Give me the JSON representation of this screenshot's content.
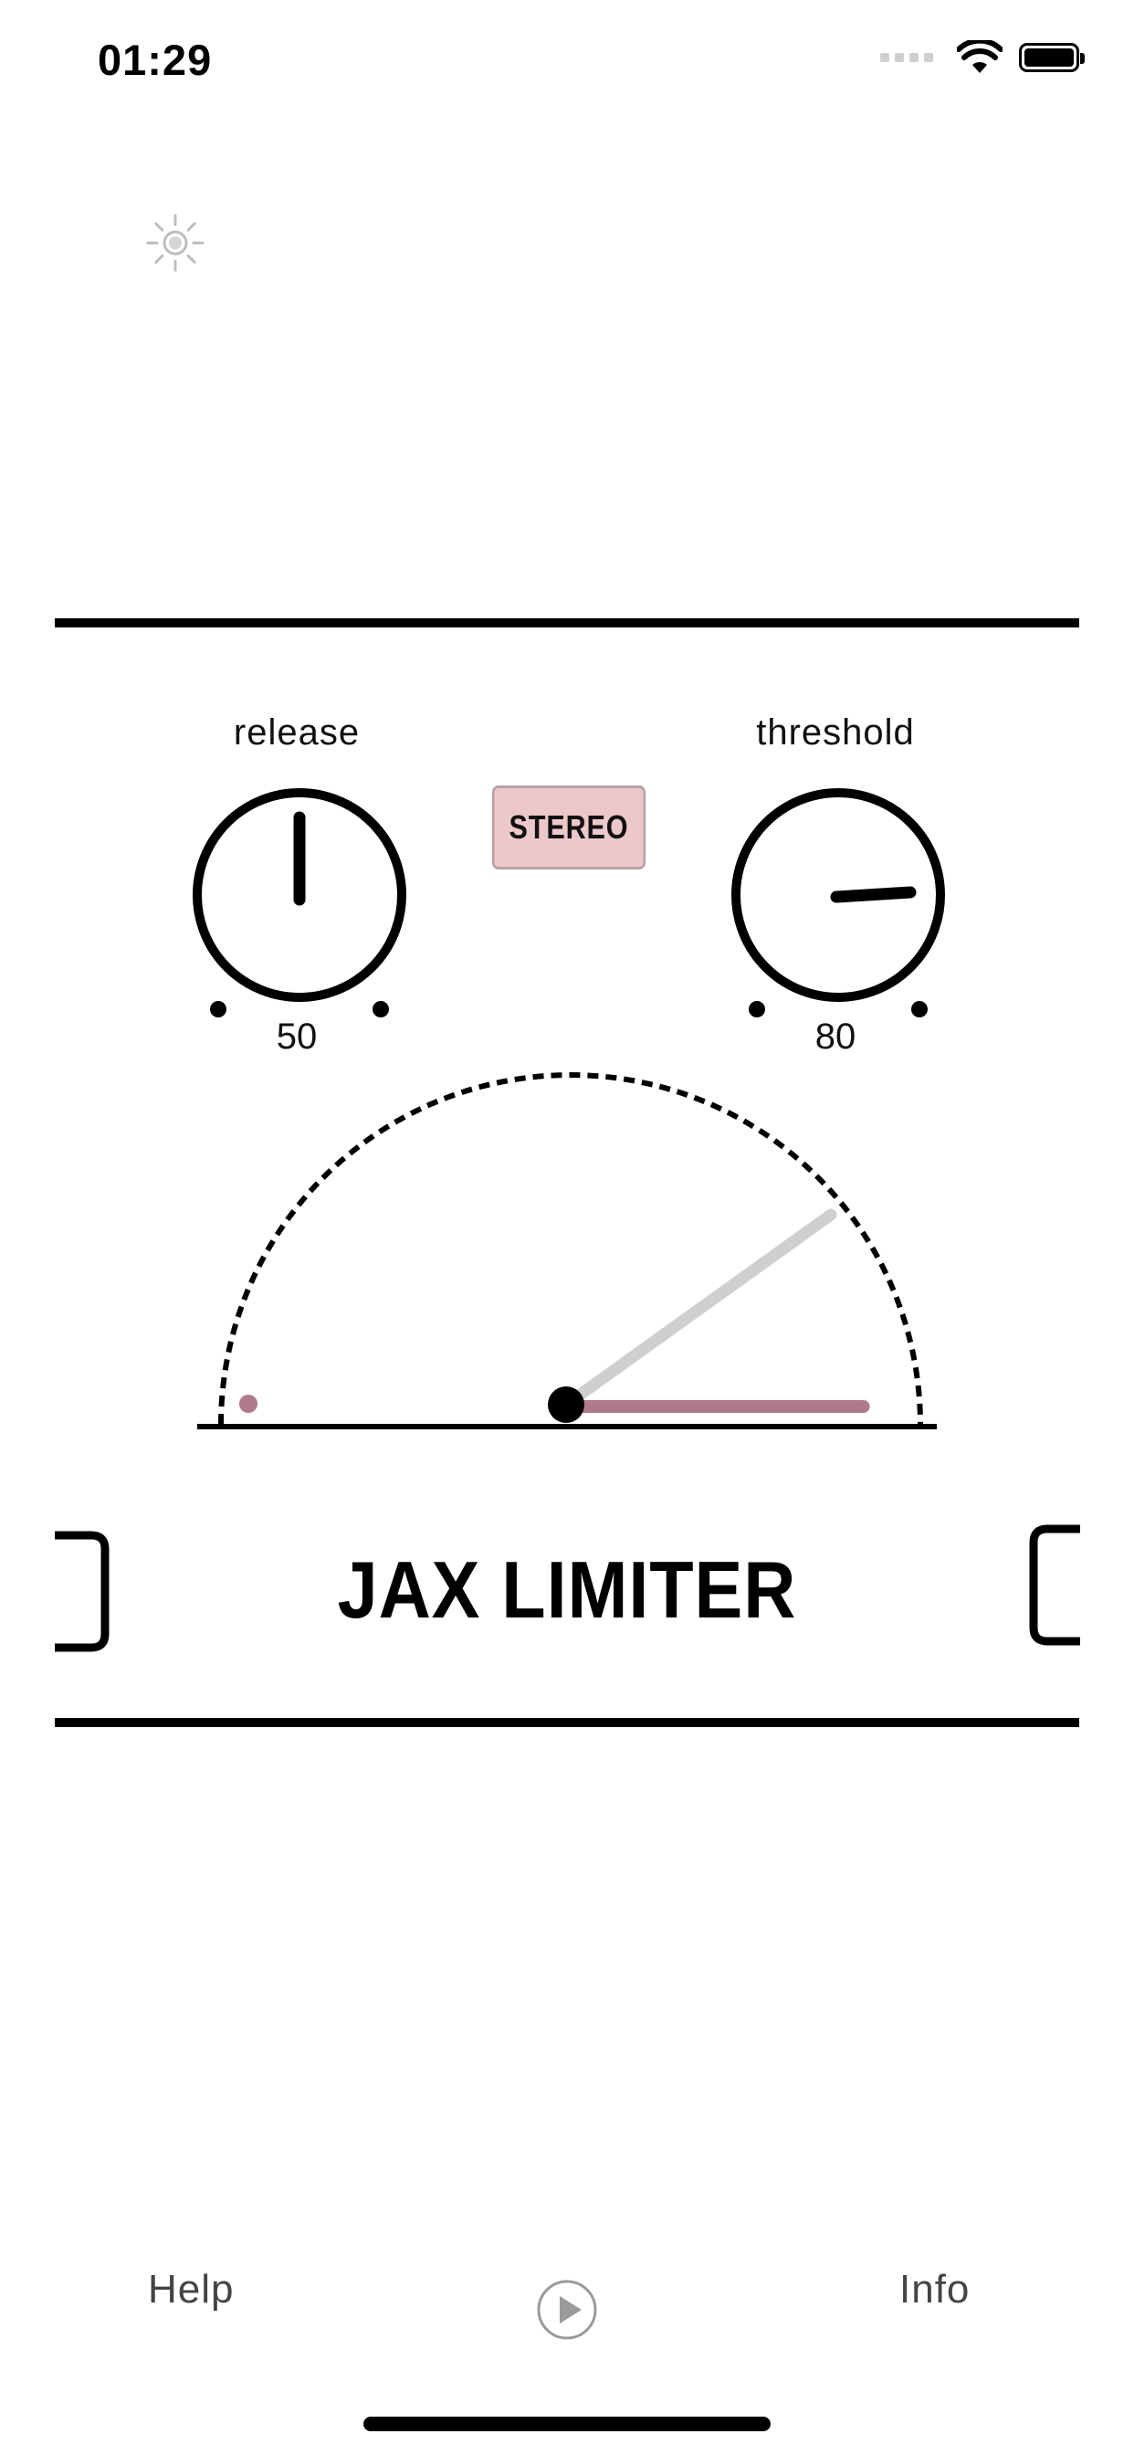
{
  "status_bar": {
    "time": "01:29"
  },
  "icons": {
    "brightness": "sun-icon",
    "wifi": "wifi-icon",
    "battery": "battery-icon",
    "play": "play-icon"
  },
  "controls": {
    "release": {
      "label": "release",
      "value": "50"
    },
    "threshold": {
      "label": "threshold",
      "value": "80"
    },
    "stereo_label": "STEREO"
  },
  "meter": {
    "level_fraction": 0.88
  },
  "plugin": {
    "title": "JAX LIMITER"
  },
  "footer": {
    "help_label": "Help",
    "info_label": "Info"
  },
  "colors": {
    "stereo_bg": "#ecc8cb",
    "meter_bar": "#b07a8a",
    "needle": "#cfcfcf"
  }
}
